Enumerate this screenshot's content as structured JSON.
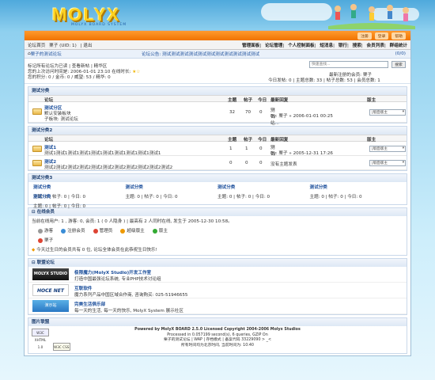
{
  "banner": {
    "logo": "MOLYX",
    "logo_sub": "MOLYX BOARD SYSTEM"
  },
  "topbar": {
    "buttons": [
      "注册",
      "登录",
      "帮助"
    ]
  },
  "navbar": {
    "left": [
      "论坛首页",
      "| 退出"
    ],
    "user": "栗子 (UID: 1)",
    "right": [
      "管理面板",
      "论坛管理",
      "个人控制面板",
      "短消息",
      "银行",
      "搜索",
      "会员列表",
      "群组统计"
    ]
  },
  "announce": {
    "crumb": "栗子的测试论坛",
    "notice": "论坛公告: 测试测试测试测试测试测试测试测试测试测试测试",
    "page": "(0/0)"
  },
  "userbox": {
    "line1": "标记所有论坛为已读 | 查看新帖 | 精华区",
    "line2": "您的上次访问时间是: 2006-01-01 23:10  在线时长:",
    "line3": "您的积分: 0 / 金币: 0 / 威望: 53 / 精华: 0",
    "search_placeholder": "快速查找...",
    "search_btn": "搜索",
    "newest": "最新注册的会员: 栗子",
    "stats": "今日发帖: 0 | 主题总数: 33 | 帖子总数: 53 | 会员总数: 1"
  },
  "cat1": {
    "title": "测试分类",
    "headers": {
      "forum": "论坛",
      "topics": "主题",
      "posts": "帖子",
      "today": "今日",
      "last": "最新回复",
      "mod": "版主"
    },
    "forums": [
      {
        "name": "测试分区",
        "desc": "默认安装板块",
        "sub": "子板块: 测试论坛",
        "topics": "32",
        "posts": "70",
        "today": "0",
        "last1": "测试站...",
        "last2": "By: 栗子 » 2006-01-01 00:25",
        "mod": "|版面版主 "
      }
    ]
  },
  "cat2": {
    "title": "测试分类2",
    "headers": {
      "forum": "论坛",
      "topics": "主题",
      "posts": "帖子",
      "today": "今日",
      "last": "最新回复",
      "mod": "版主"
    },
    "forums": [
      {
        "name": "测试1",
        "desc": "测试1测试1测试1测试1测试1测试1测试1测试1测试1测试1",
        "topics": "1",
        "posts": "1",
        "today": "0",
        "last1": "测试测试...",
        "last2": "By: 栗子 » 2005-12-31 17:26",
        "mod": "|版面版主 "
      },
      {
        "name": "测试2",
        "desc": "测试2测试2测试2测试2测试2测试2测试2测试2测试2测试2测试2",
        "topics": "0",
        "posts": "0",
        "today": "0",
        "last1": "没有主题发表",
        "last2": "",
        "mod": "|版面版主 "
      }
    ]
  },
  "cat3": {
    "title": "测试分类3",
    "cells": [
      {
        "name": "测试分类",
        "stat": "主题: 0 | 帖子: 0 | 今日: 0"
      },
      {
        "name": "测试分类",
        "stat": "主题: 0 | 帖子: 0 | 今日: 0"
      },
      {
        "name": "测试分类",
        "stat": "主题: 0 | 帖子: 0 | 今日: 0"
      },
      {
        "name": "测试分类",
        "stat": "主题: 0 | 帖子: 0 | 今日: 0"
      },
      {
        "name": "测试分类",
        "stat": "主题: 0 | 帖子: 0 | 今日: 0"
      }
    ]
  },
  "online": {
    "title": "在线会员",
    "summary": "当前在线用户: 1 , 游客: 0, 会员: 1 ( 0 人隐身 ) | 最高有 2 人同时在线, 发生于 2005-12-30 10:58。",
    "legend": [
      "游客",
      "注册会员",
      "管理员",
      "超级版主",
      "版主"
    ],
    "user": "栗子",
    "birthday": "今天过生日的会员共有 0 位, 论坛全体会员在此恭祝生日快乐!"
  },
  "links": {
    "title": "联盟论坛",
    "items": [
      {
        "logo": "MOLYX STUDIO",
        "name": "极限魔力(MolyX Studio)开发工作室",
        "desc": "打造中国最强论坛系统, 专业PHP技术讨论组"
      },
      {
        "logo": "HOCE NET",
        "name": "互联软件",
        "desc": "魔力系列产品中国区域合作商, 咨询购买: 025-51946655"
      },
      {
        "logo": "演示站",
        "name": "完美生活俱乐部",
        "desc": "每一天的生活, 每一天的快乐, MolyX System 展示社区"
      }
    ]
  },
  "badges": {
    "title": "图片联盟",
    "items": [
      "W3C XHTML 1.0",
      "W3C CSS"
    ]
  },
  "footer": {
    "line1": "Powered by MolyX BOARD 2.5.0 Licensed Copyright 2004-2006 Molyx Studios",
    "line2": "Processed in 0.057199 second(s), 6 queries, GZIP On",
    "line3": "栗子的测试论坛 | WAP | 存档模式 | 备案代码 33229090 > _<",
    "line4": "所有时间均为北京时间, 当前时间为: 10:40"
  },
  "colors": {
    "accent": "#f07300",
    "link": "#1b4e9b",
    "section_bg": "#dde8f5"
  }
}
